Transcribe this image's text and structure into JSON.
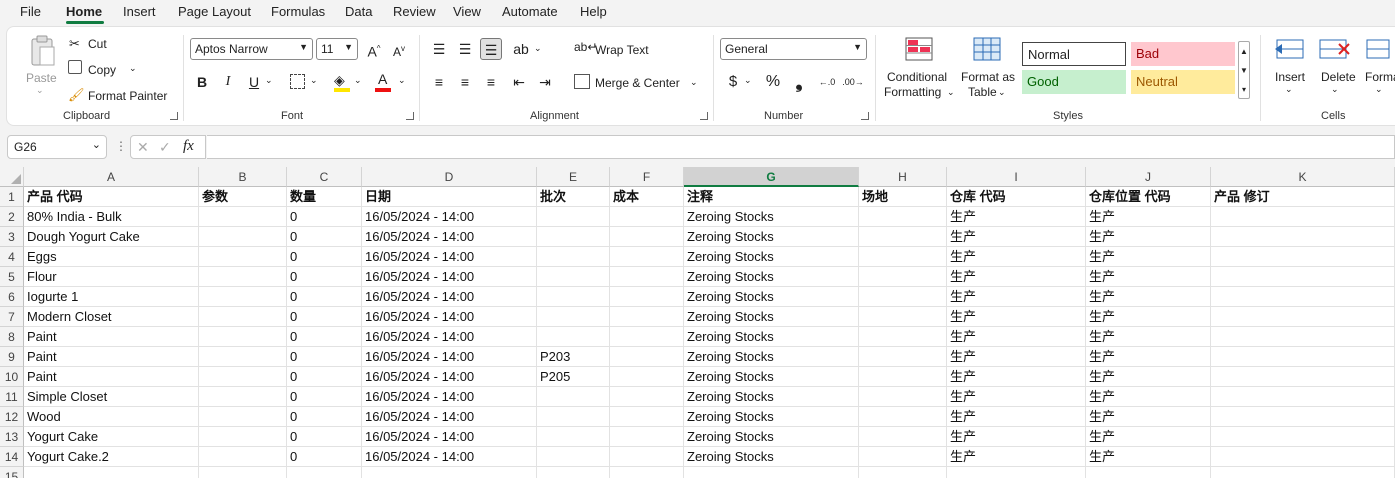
{
  "menu": [
    "File",
    "Home",
    "Insert",
    "Page Layout",
    "Formulas",
    "Data",
    "Review",
    "View",
    "Automate",
    "Help"
  ],
  "clipboard": {
    "paste": "Paste",
    "cut": "Cut",
    "copy": "Copy",
    "format_painter": "Format Painter",
    "group": "Clipboard"
  },
  "font": {
    "name": "Aptos Narrow",
    "size": "11",
    "group": "Font",
    "bold": "B",
    "italic": "I",
    "underline": "U"
  },
  "alignment": {
    "wrap_text": "Wrap Text",
    "merge_center": "Merge & Center",
    "group": "Alignment"
  },
  "number": {
    "format": "General",
    "currency": "$",
    "percent": "%",
    "comma": "❟",
    "group": "Number"
  },
  "styles": {
    "conditional": [
      "Conditional",
      "Formatting"
    ],
    "format_table": [
      "Format as",
      "Table"
    ],
    "normal": "Normal",
    "bad": "Bad",
    "good": "Good",
    "neutral": "Neutral",
    "group": "Styles"
  },
  "cells": {
    "insert": "Insert",
    "delete": "Delete",
    "format": "Format",
    "group": "Cells"
  },
  "name_box": "G26",
  "fx": "fx",
  "columns": [
    "A",
    "B",
    "C",
    "D",
    "E",
    "F",
    "G",
    "H",
    "I",
    "J",
    "K"
  ],
  "selected_column": "G",
  "headers": [
    "产品 代码",
    "参数",
    "数量",
    "日期",
    "批次",
    "成本",
    "注释",
    "场地",
    "仓库 代码",
    "仓库位置 代码",
    "产品 修订"
  ],
  "rows": [
    [
      "80% India - Bulk",
      "",
      "0",
      "16/05/2024 - 14:00",
      "",
      "",
      "Zeroing Stocks",
      "",
      "生产",
      "生产",
      ""
    ],
    [
      "Dough Yogurt Cake",
      "",
      "0",
      "16/05/2024 - 14:00",
      "",
      "",
      "Zeroing Stocks",
      "",
      "生产",
      "生产",
      ""
    ],
    [
      "Eggs",
      "",
      "0",
      "16/05/2024 - 14:00",
      "",
      "",
      "Zeroing Stocks",
      "",
      "生产",
      "生产",
      ""
    ],
    [
      "Flour",
      "",
      "0",
      "16/05/2024 - 14:00",
      "",
      "",
      "Zeroing Stocks",
      "",
      "生产",
      "生产",
      ""
    ],
    [
      "Iogurte 1",
      "",
      "0",
      "16/05/2024 - 14:00",
      "",
      "",
      "Zeroing Stocks",
      "",
      "生产",
      "生产",
      ""
    ],
    [
      "Modern Closet",
      "",
      "0",
      "16/05/2024 - 14:00",
      "",
      "",
      "Zeroing Stocks",
      "",
      "生产",
      "生产",
      ""
    ],
    [
      "Paint",
      "",
      "0",
      "16/05/2024 - 14:00",
      "",
      "",
      "Zeroing Stocks",
      "",
      "生产",
      "生产",
      ""
    ],
    [
      "Paint",
      "",
      "0",
      "16/05/2024 - 14:00",
      "P203",
      "",
      "Zeroing Stocks",
      "",
      "生产",
      "生产",
      ""
    ],
    [
      "Paint",
      "",
      "0",
      "16/05/2024 - 14:00",
      "P205",
      "",
      "Zeroing Stocks",
      "",
      "生产",
      "生产",
      ""
    ],
    [
      "Simple Closet",
      "",
      "0",
      "16/05/2024 - 14:00",
      "",
      "",
      "Zeroing Stocks",
      "",
      "生产",
      "生产",
      ""
    ],
    [
      "Wood",
      "",
      "0",
      "16/05/2024 - 14:00",
      "",
      "",
      "Zeroing Stocks",
      "",
      "生产",
      "生产",
      ""
    ],
    [
      "Yogurt Cake",
      "",
      "0",
      "16/05/2024 - 14:00",
      "",
      "",
      "Zeroing Stocks",
      "",
      "生产",
      "生产",
      ""
    ],
    [
      "Yogurt Cake.2",
      "",
      "0",
      "16/05/2024 - 14:00",
      "",
      "",
      "Zeroing Stocks",
      "",
      "生产",
      "生产",
      ""
    ]
  ],
  "row_numbers": [
    "1",
    "2",
    "3",
    "4",
    "5",
    "6",
    "7",
    "8",
    "9",
    "10",
    "11",
    "12",
    "13",
    "14",
    "15"
  ]
}
